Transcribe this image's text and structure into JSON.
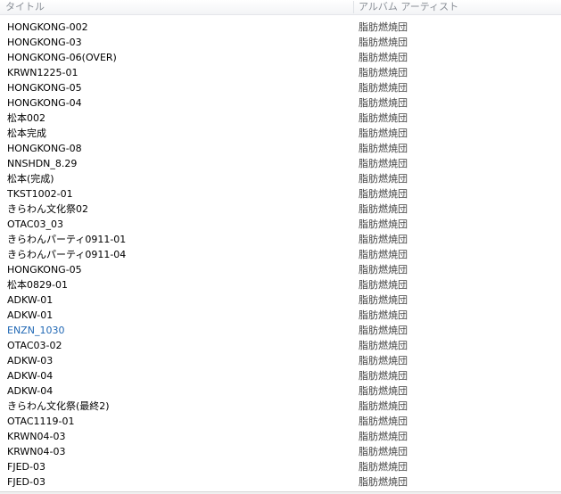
{
  "columns": {
    "title": "タイトル",
    "artist": "アルバム アーティスト"
  },
  "colors": {
    "highlight_text": "#1f67b4",
    "header_text": "#8a8f97"
  },
  "rows": [
    {
      "title": "HONGKONG-002",
      "artist": "脂肪燃焼団"
    },
    {
      "title": "HONGKONG-03",
      "artist": "脂肪燃焼団"
    },
    {
      "title": "HONGKONG-06(OVER)",
      "artist": "脂肪燃焼団"
    },
    {
      "title": "KRWN1225-01",
      "artist": "脂肪燃焼団"
    },
    {
      "title": "HONGKONG-05",
      "artist": "脂肪燃焼団"
    },
    {
      "title": "HONGKONG-04",
      "artist": "脂肪燃焼団"
    },
    {
      "title": "松本002",
      "artist": "脂肪燃焼団"
    },
    {
      "title": "松本完成",
      "artist": "脂肪燃焼団"
    },
    {
      "title": "HONGKONG-08",
      "artist": "脂肪燃焼団"
    },
    {
      "title": "NNSHDN_8.29",
      "artist": "脂肪燃焼団"
    },
    {
      "title": "松本(完成)",
      "artist": "脂肪燃焼団"
    },
    {
      "title": "TKST1002-01",
      "artist": "脂肪燃焼団"
    },
    {
      "title": "きらわん文化祭02",
      "artist": "脂肪燃焼団"
    },
    {
      "title": "OTAC03_03",
      "artist": "脂肪燃焼団"
    },
    {
      "title": "きらわんパーティ0911-01",
      "artist": "脂肪燃焼団"
    },
    {
      "title": "きらわんパーティ0911-04",
      "artist": "脂肪燃焼団"
    },
    {
      "title": "HONGKONG-05",
      "artist": "脂肪燃焼団"
    },
    {
      "title": "松本0829-01",
      "artist": "脂肪燃焼団"
    },
    {
      "title": "ADKW-01",
      "artist": "脂肪燃焼団"
    },
    {
      "title": "ADKW-01",
      "artist": "脂肪燃焼団"
    },
    {
      "title": "ENZN_1030",
      "artist": "脂肪燃焼団",
      "highlighted": true
    },
    {
      "title": "OTAC03-02",
      "artist": "脂肪燃焼団"
    },
    {
      "title": "ADKW-03",
      "artist": "脂肪燃焼団"
    },
    {
      "title": "ADKW-04",
      "artist": "脂肪燃焼団"
    },
    {
      "title": "ADKW-04",
      "artist": "脂肪燃焼団"
    },
    {
      "title": "きらわん文化祭(最終2)",
      "artist": "脂肪燃焼団"
    },
    {
      "title": "OTAC1119-01",
      "artist": "脂肪燃焼団"
    },
    {
      "title": "KRWN04-03",
      "artist": "脂肪燃焼団"
    },
    {
      "title": "KRWN04-03",
      "artist": "脂肪燃焼団"
    },
    {
      "title": "FJED-03",
      "artist": "脂肪燃焼団"
    },
    {
      "title": "FJED-03",
      "artist": "脂肪燃焼団"
    }
  ]
}
